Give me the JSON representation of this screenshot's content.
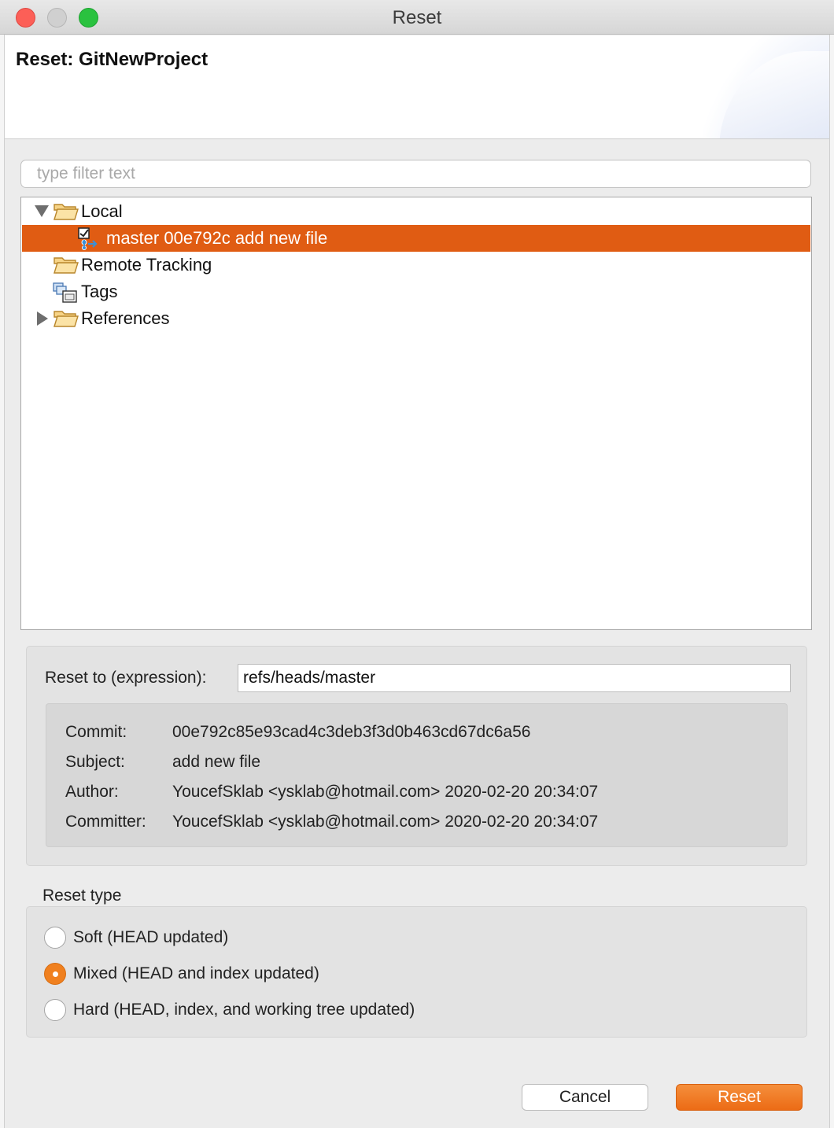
{
  "window": {
    "title": "Reset",
    "close_color": "#fc5f57",
    "minimize_color": "#d0d0d0",
    "maximize_color": "#2ac23f"
  },
  "banner": {
    "title": "Reset: GitNewProject"
  },
  "filter": {
    "placeholder": "type filter text",
    "value": ""
  },
  "tree": {
    "selection_color": "#e05c13",
    "items": [
      {
        "label": "Local",
        "icon": "folder-open-icon",
        "expanded": true
      },
      {
        "label": "master 00e792c add new file",
        "icon": "branch-icon",
        "selected": true
      },
      {
        "label": "Remote Tracking",
        "icon": "folder-open-icon"
      },
      {
        "label": "Tags",
        "icon": "tags-icon"
      },
      {
        "label": "References",
        "icon": "folder-open-icon",
        "expanded": false
      }
    ]
  },
  "expression": {
    "label": "Reset to (expression):",
    "value": "refs/heads/master"
  },
  "commit": {
    "commit_label": "Commit:",
    "commit_value": "00e792c85e93cad4c3deb3f3d0b463cd67dc6a56",
    "subject_label": "Subject:",
    "subject_value": "add new file",
    "author_label": "Author:",
    "author_value": "YoucefSklab <ysklab@hotmail.com> 2020-02-20 20:34:07",
    "committer_label": "Committer:",
    "committer_value": "YoucefSklab <ysklab@hotmail.com> 2020-02-20 20:34:07"
  },
  "reset_type": {
    "label": "Reset type",
    "options": [
      {
        "label": "Soft (HEAD updated)",
        "checked": false
      },
      {
        "label": "Mixed (HEAD and index updated)",
        "checked": true
      },
      {
        "label": "Hard (HEAD, index, and working tree updated)",
        "checked": false
      }
    ],
    "accent_color": "#f0801f"
  },
  "buttons": {
    "cancel_label": "Cancel",
    "reset_label": "Reset",
    "primary_color": "#ec6b15"
  }
}
